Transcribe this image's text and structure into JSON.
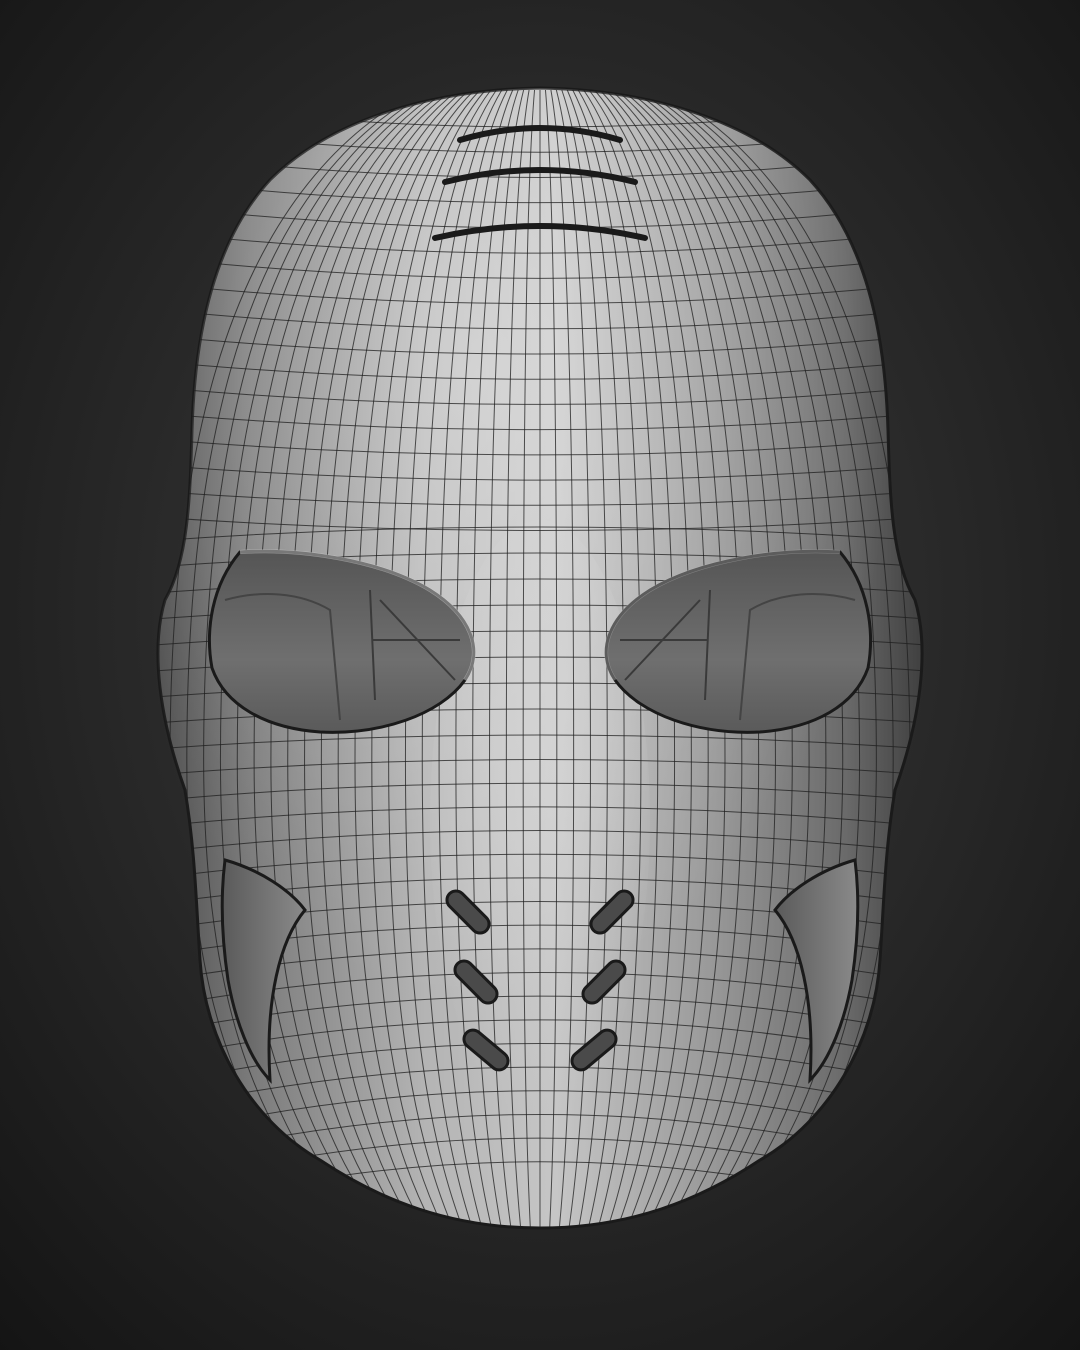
{
  "scene": {
    "subject": "mask-wireframe-render",
    "background_color_center": "#3d3d3d",
    "background_color_edge": "#141414",
    "mesh_base_color": "#a6a6a6",
    "mesh_highlight_color": "#dcdcdc",
    "mesh_shadow_color": "#4a4a4a",
    "wire_color": "#1e1e1e",
    "cavity_color": "#6a6a6a",
    "slot_color": "#1a1a1a",
    "forehead_slots": 3,
    "mouth_vents": 6
  }
}
